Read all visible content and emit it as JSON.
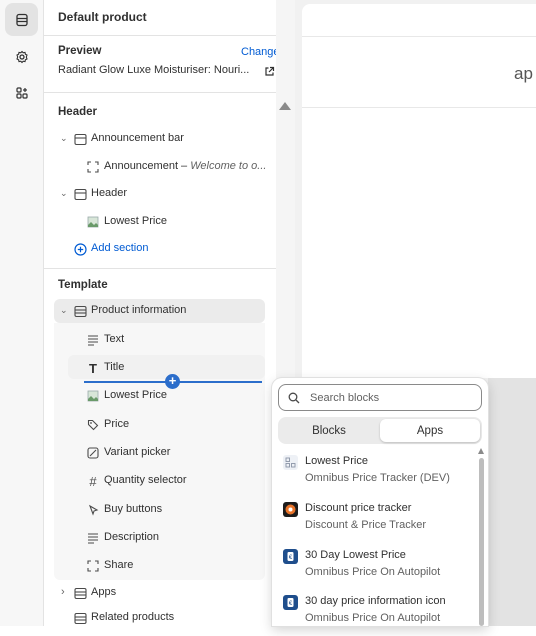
{
  "rail": {
    "items": [
      {
        "icon": "sections-icon"
      },
      {
        "icon": "gear-icon"
      },
      {
        "icon": "apps-icon"
      }
    ]
  },
  "panel": {
    "title": "Default product",
    "preview_label": "Preview",
    "change_label": "Change",
    "preview_value": "Radiant Glow Luxe Moisturiser: Nouri...",
    "header_group": "Header",
    "announcement_bar": "Announcement bar",
    "announcement_name": "Announcement",
    "announcement_detail": "Welcome to o...",
    "header_section": "Header",
    "header_lowest_price": "Lowest Price",
    "add_section": "Add section",
    "template_group": "Template",
    "product_information": "Product information",
    "blocks": [
      "Text",
      "Title",
      "Lowest Price",
      "Price",
      "Variant picker",
      "Quantity selector",
      "Buy buttons",
      "Description",
      "Share"
    ],
    "apps": "Apps",
    "related_products": "Related products"
  },
  "preview": {
    "text": "ap"
  },
  "popup": {
    "search_placeholder": "Search blocks",
    "tab_blocks": "Blocks",
    "tab_apps": "Apps",
    "active_tab": "Apps",
    "items": [
      {
        "name": "Lowest Price",
        "app": "Omnibus Price Tracker (DEV)",
        "icon_color": "#e8ecf3"
      },
      {
        "name": "Discount price tracker",
        "app": "Discount & Price Tracker",
        "icon_color": "#e8742a"
      },
      {
        "name": "30 Day Lowest Price",
        "app": "Omnibus Price On Autopilot",
        "icon_color": "#1f4e8c"
      },
      {
        "name": "30 day price information icon",
        "app": "Omnibus Price On Autopilot",
        "icon_color": "#1f4e8c"
      }
    ]
  },
  "colors": {
    "accent": "#005bd3",
    "selected_row": "#ebebeb",
    "insert_line": "#2c6ecb"
  }
}
